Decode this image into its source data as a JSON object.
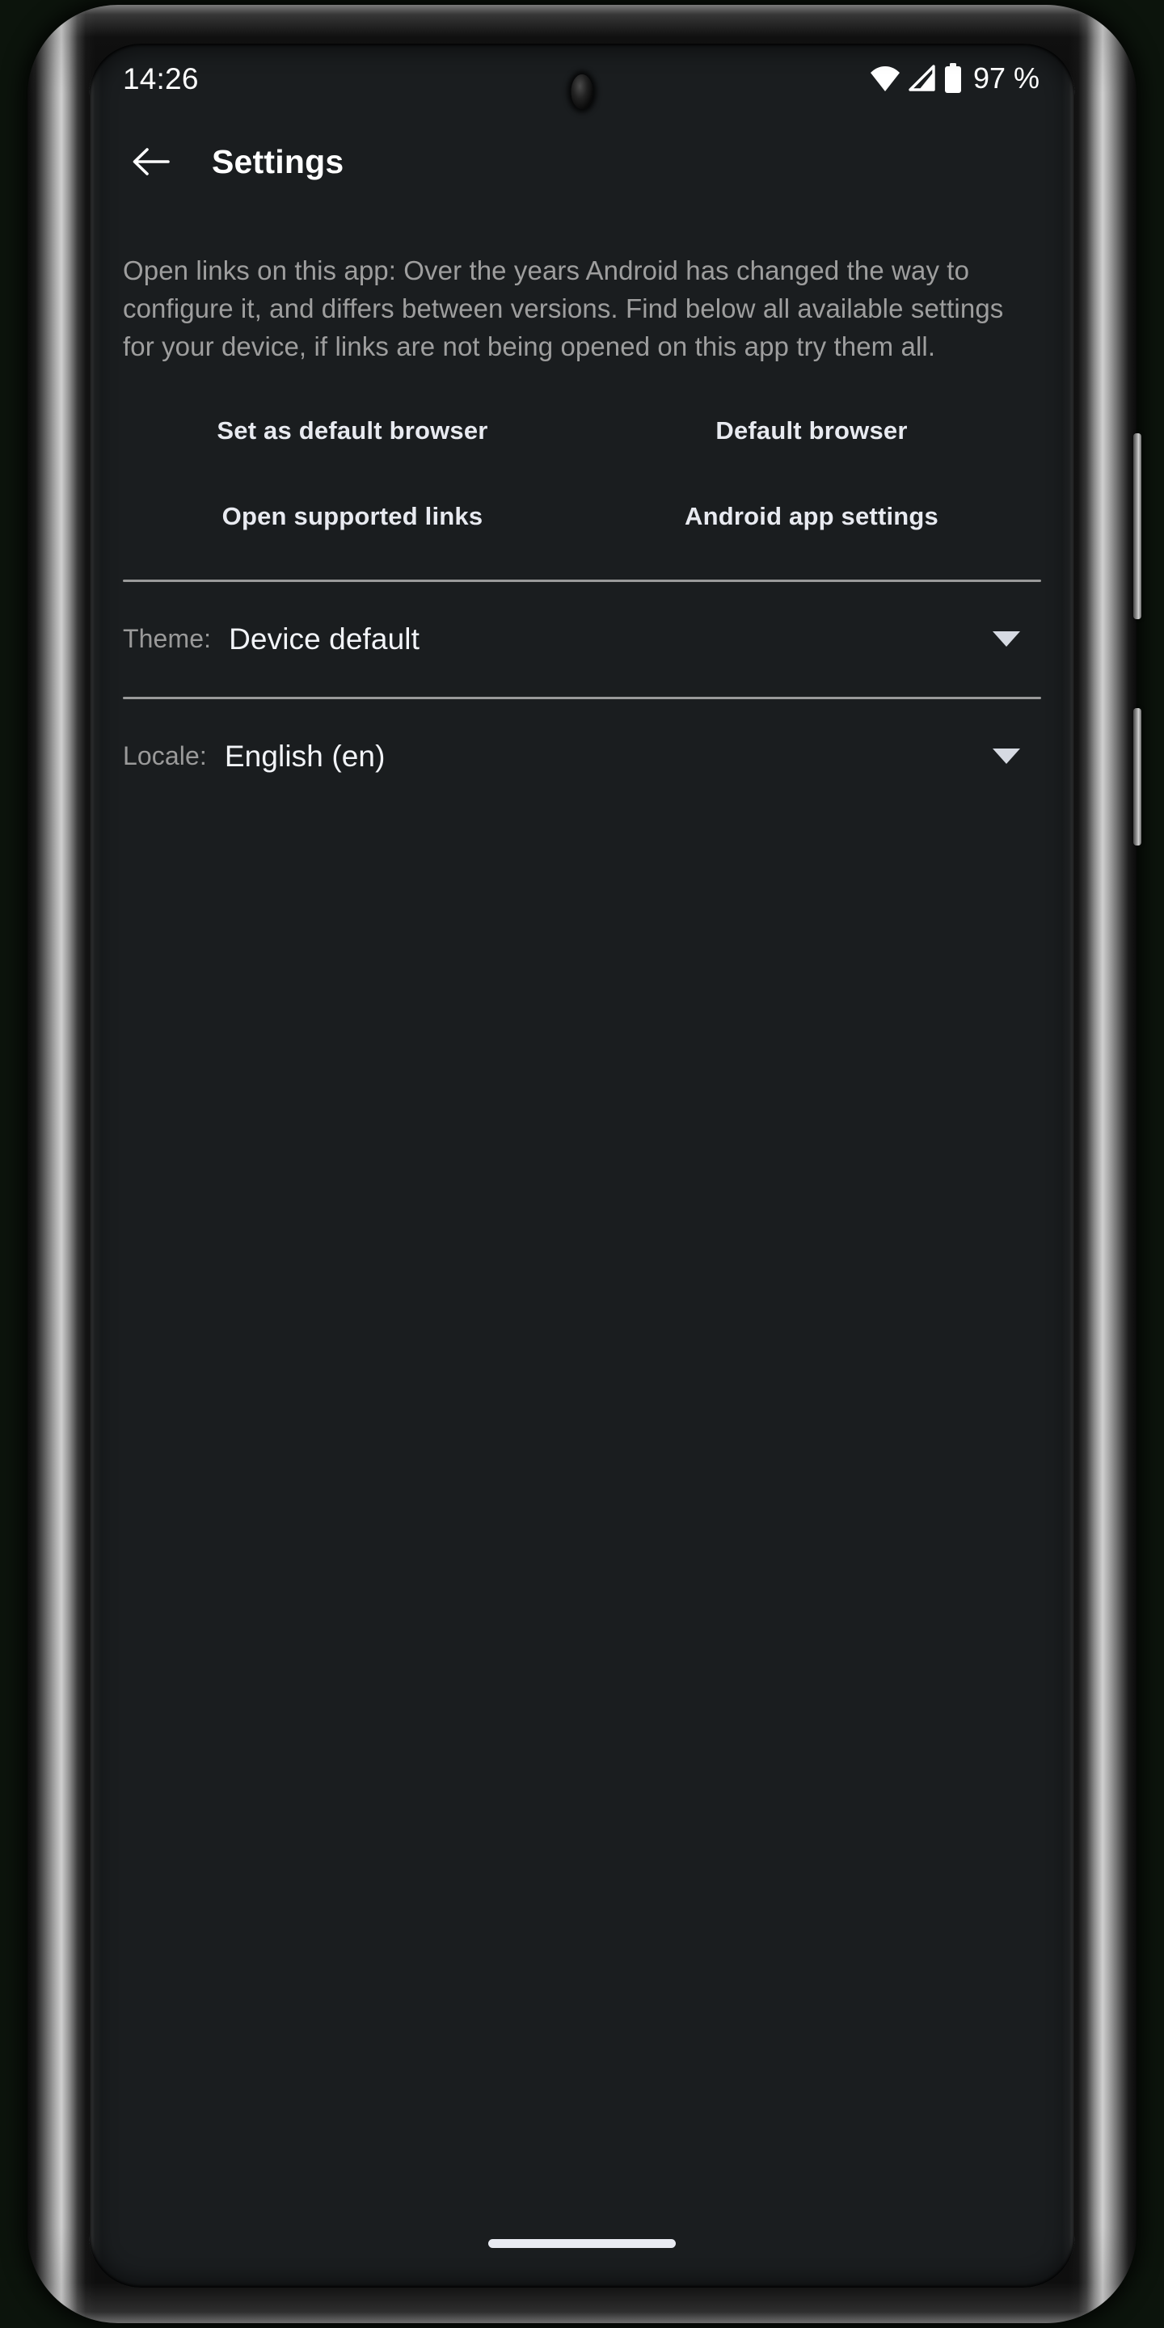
{
  "status_bar": {
    "clock": "14:26",
    "battery_percent": "97 %",
    "icons": [
      "wifi-icon",
      "cellular-signal-icon",
      "battery-icon"
    ]
  },
  "toolbar": {
    "back_label": "back-arrow",
    "title": "Settings"
  },
  "main": {
    "intro_text": "Open links on this app: Over the years Android has changed the way to configure it, and differs between versions. Find below all available settings for your device, if links are not being opened on this app try them all.",
    "buttons": [
      {
        "label": "Set as default browser",
        "name": "set-as-default-browser-button"
      },
      {
        "label": "Default browser",
        "name": "default-browser-button"
      },
      {
        "label": "Open supported links",
        "name": "open-supported-links-button"
      },
      {
        "label": "Android app settings",
        "name": "android-app-settings-button"
      }
    ],
    "settings": [
      {
        "label": "Theme:",
        "value": "Device default",
        "name": "theme-row"
      },
      {
        "label": "Locale:",
        "value": "English (en)",
        "name": "locale-row"
      }
    ]
  },
  "nav_bar": {
    "gesture_pill": "home-gesture-pill"
  },
  "colors": {
    "screen_background": "#1a1d1f",
    "primary_text": "#f2f4f8",
    "secondary_text": "#9a9a9a",
    "button_text": "#e8eaf0",
    "divider": "#9a9a9a",
    "accent": "#d6dae2"
  }
}
